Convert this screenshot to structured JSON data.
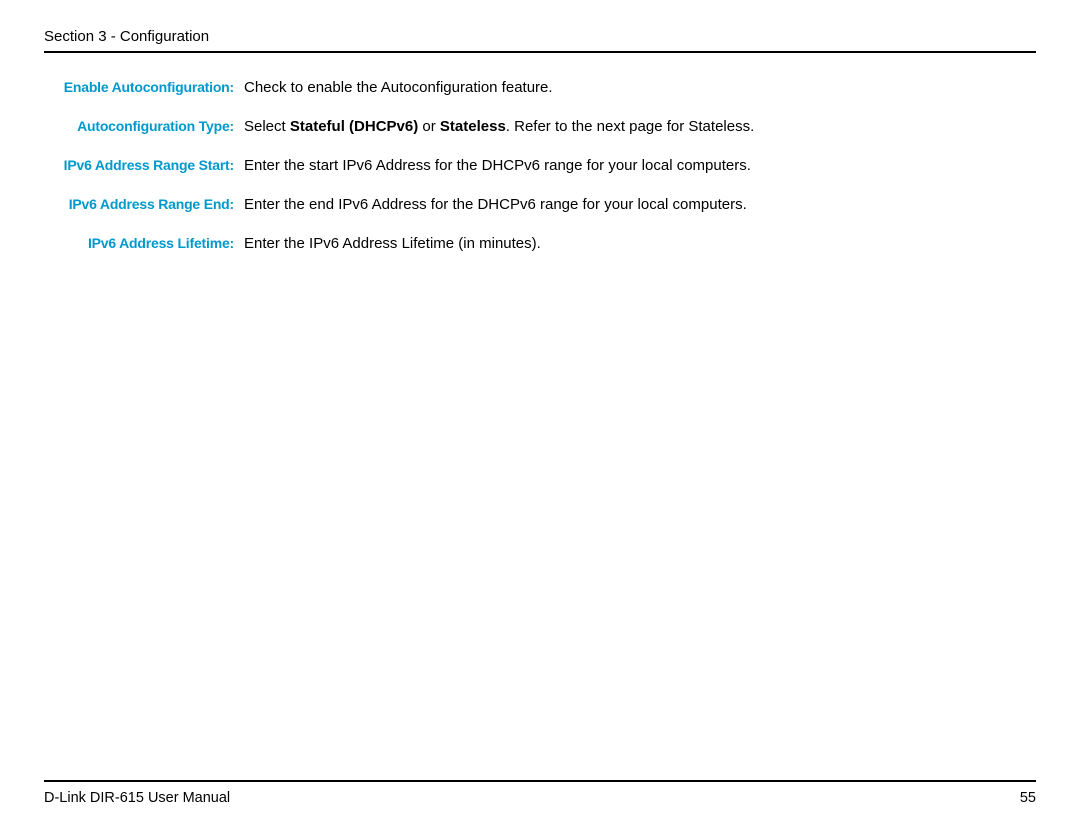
{
  "header": {
    "section_label": "Section 3 - Configuration"
  },
  "rows": [
    {
      "label": "Enable Autoconfiguration:",
      "desc_pre": "Check to enable the Autoconfiguration feature.",
      "bold1": "",
      "desc_mid": "",
      "bold2": "",
      "desc_post": ""
    },
    {
      "label": "Autoconfiguration Type:",
      "desc_pre": "Select ",
      "bold1": "Stateful (DHCPv6)",
      "desc_mid": " or ",
      "bold2": "Stateless",
      "desc_post": ". Refer to the next page for Stateless."
    },
    {
      "label": "IPv6 Address Range Start:",
      "desc_pre": "Enter the start IPv6 Address for the DHCPv6 range for your local computers.",
      "bold1": "",
      "desc_mid": "",
      "bold2": "",
      "desc_post": ""
    },
    {
      "label": "IPv6 Address Range End:",
      "desc_pre": "Enter the end IPv6 Address for the DHCPv6 range for your local computers.",
      "bold1": "",
      "desc_mid": "",
      "bold2": "",
      "desc_post": ""
    },
    {
      "label": "IPv6 Address Lifetime:",
      "desc_pre": "Enter the IPv6 Address Lifetime (in minutes).",
      "bold1": "",
      "desc_mid": "",
      "bold2": "",
      "desc_post": ""
    }
  ],
  "footer": {
    "manual_name": "D-Link DIR-615 User Manual",
    "page_number": "55"
  }
}
